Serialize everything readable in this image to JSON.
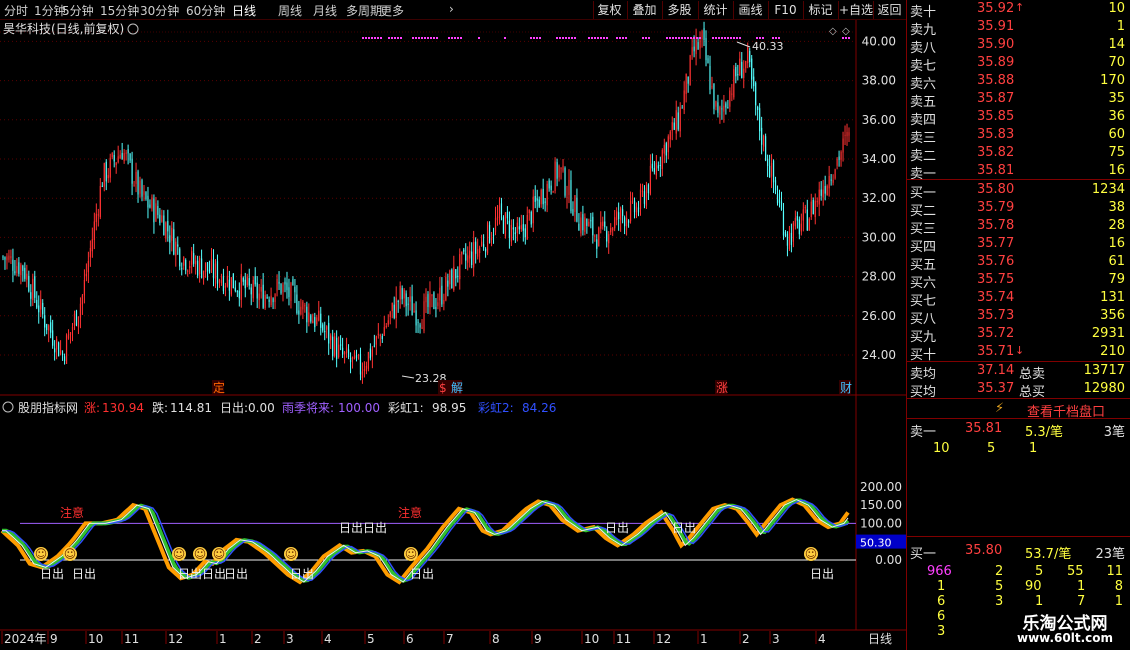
{
  "periods": [
    "分时",
    "1分钟",
    "5分钟",
    "15分钟",
    "30分钟",
    "60分钟",
    "日线",
    "周线",
    "月线",
    "多周期",
    "更多"
  ],
  "active_period": "日线",
  "toolbar": [
    "复权",
    "叠加",
    "多股",
    "统计",
    "画线",
    "F10",
    "标记",
    "+自选",
    "返回"
  ],
  "stock_title": "昊华科技(日线,前复权)",
  "price_axis": [
    "40.00",
    "38.00",
    "36.00",
    "34.00",
    "32.00",
    "30.00",
    "28.00",
    "26.00",
    "24.00"
  ],
  "max_label": "40.33",
  "min_label": "23.28",
  "event_tags": [
    {
      "text": "定",
      "color": "#ff6600"
    },
    {
      "text": "$",
      "color": "#ff4040"
    },
    {
      "text": "解",
      "color": "#40c0ff"
    },
    {
      "text": "涨",
      "color": "#ff4040"
    },
    {
      "text": "财",
      "color": "#40c0ff"
    }
  ],
  "indicator": {
    "name": "股朋指标网",
    "items": [
      {
        "label": "涨:",
        "value": "130.94",
        "color": "#ff3030"
      },
      {
        "label": "跌:",
        "value": "114.81",
        "color": "#e0e0e0"
      },
      {
        "label": "日出:",
        "value": "0.00",
        "color": "#e0e0e0"
      },
      {
        "label": "雨季将来:",
        "value": "100.00",
        "color": "#a060ff"
      },
      {
        "label": "彩虹1:",
        "value": "98.95",
        "color": "#e0e0e0"
      },
      {
        "label": "彩虹2:",
        "value": "84.26",
        "color": "#3050ff"
      }
    ],
    "axis": [
      "200.00",
      "150.00",
      "100.00",
      "50.00",
      "0.00"
    ],
    "current_value": "50.30",
    "signal_zhuyi": "注意",
    "signal_richu": "日出",
    "signal_smiley": "☺"
  },
  "date_axis": [
    "2024年",
    "9",
    "10",
    "11",
    "12",
    "1",
    "2",
    "3",
    "4",
    "5",
    "6",
    "7",
    "8",
    "9",
    "10",
    "11",
    "12",
    "1",
    "2",
    "3",
    "4"
  ],
  "period_label": "日线",
  "orderbook": {
    "sells": [
      {
        "label": "卖十",
        "price": "35.92",
        "vol": "10",
        "arrow": "↑"
      },
      {
        "label": "卖九",
        "price": "35.91",
        "vol": "1"
      },
      {
        "label": "卖八",
        "price": "35.90",
        "vol": "14"
      },
      {
        "label": "卖七",
        "price": "35.89",
        "vol": "70"
      },
      {
        "label": "卖六",
        "price": "35.88",
        "vol": "170"
      },
      {
        "label": "卖五",
        "price": "35.87",
        "vol": "35"
      },
      {
        "label": "卖四",
        "price": "35.85",
        "vol": "36"
      },
      {
        "label": "卖三",
        "price": "35.83",
        "vol": "60"
      },
      {
        "label": "卖二",
        "price": "35.82",
        "vol": "75"
      },
      {
        "label": "卖一",
        "price": "35.81",
        "vol": "16"
      }
    ],
    "buys": [
      {
        "label": "买一",
        "price": "35.80",
        "vol": "1234"
      },
      {
        "label": "买二",
        "price": "35.79",
        "vol": "38"
      },
      {
        "label": "买三",
        "price": "35.78",
        "vol": "28"
      },
      {
        "label": "买四",
        "price": "35.77",
        "vol": "16"
      },
      {
        "label": "买五",
        "price": "35.76",
        "vol": "61"
      },
      {
        "label": "买六",
        "price": "35.75",
        "vol": "79"
      },
      {
        "label": "买七",
        "price": "35.74",
        "vol": "131"
      },
      {
        "label": "买八",
        "price": "35.73",
        "vol": "356"
      },
      {
        "label": "买九",
        "price": "35.72",
        "vol": "2931"
      },
      {
        "label": "买十",
        "price": "35.71",
        "vol": "210",
        "arrow": "↓"
      }
    ],
    "avg_sell_label": "卖均",
    "avg_sell": "37.14",
    "total_sell_label": "总卖",
    "total_sell": "13717",
    "avg_buy_label": "买均",
    "avg_buy": "35.37",
    "total_buy_label": "总买",
    "total_buy": "12980",
    "view_link": "查看千档盘口",
    "q_sell_label": "卖一",
    "q_sell_price": "35.81",
    "q_sell_amt": "5.3/笔",
    "q_sell_count": "3笔",
    "q_sell_orders": [
      "10",
      "5",
      "1"
    ],
    "q_buy_label": "买一",
    "q_buy_price": "35.80",
    "q_buy_amt": "53.7/笔",
    "q_buy_count": "23笔",
    "q_buy_orders": [
      [
        "966",
        "2",
        "5",
        "55",
        "11"
      ],
      [
        "1",
        "5",
        "90",
        "1",
        "8"
      ],
      [
        "6",
        "3",
        "1",
        "7",
        "1"
      ],
      [
        "6"
      ],
      [
        "3"
      ]
    ]
  },
  "watermark": {
    "title": "乐淘公式网",
    "url": "www.60lt.com"
  }
}
